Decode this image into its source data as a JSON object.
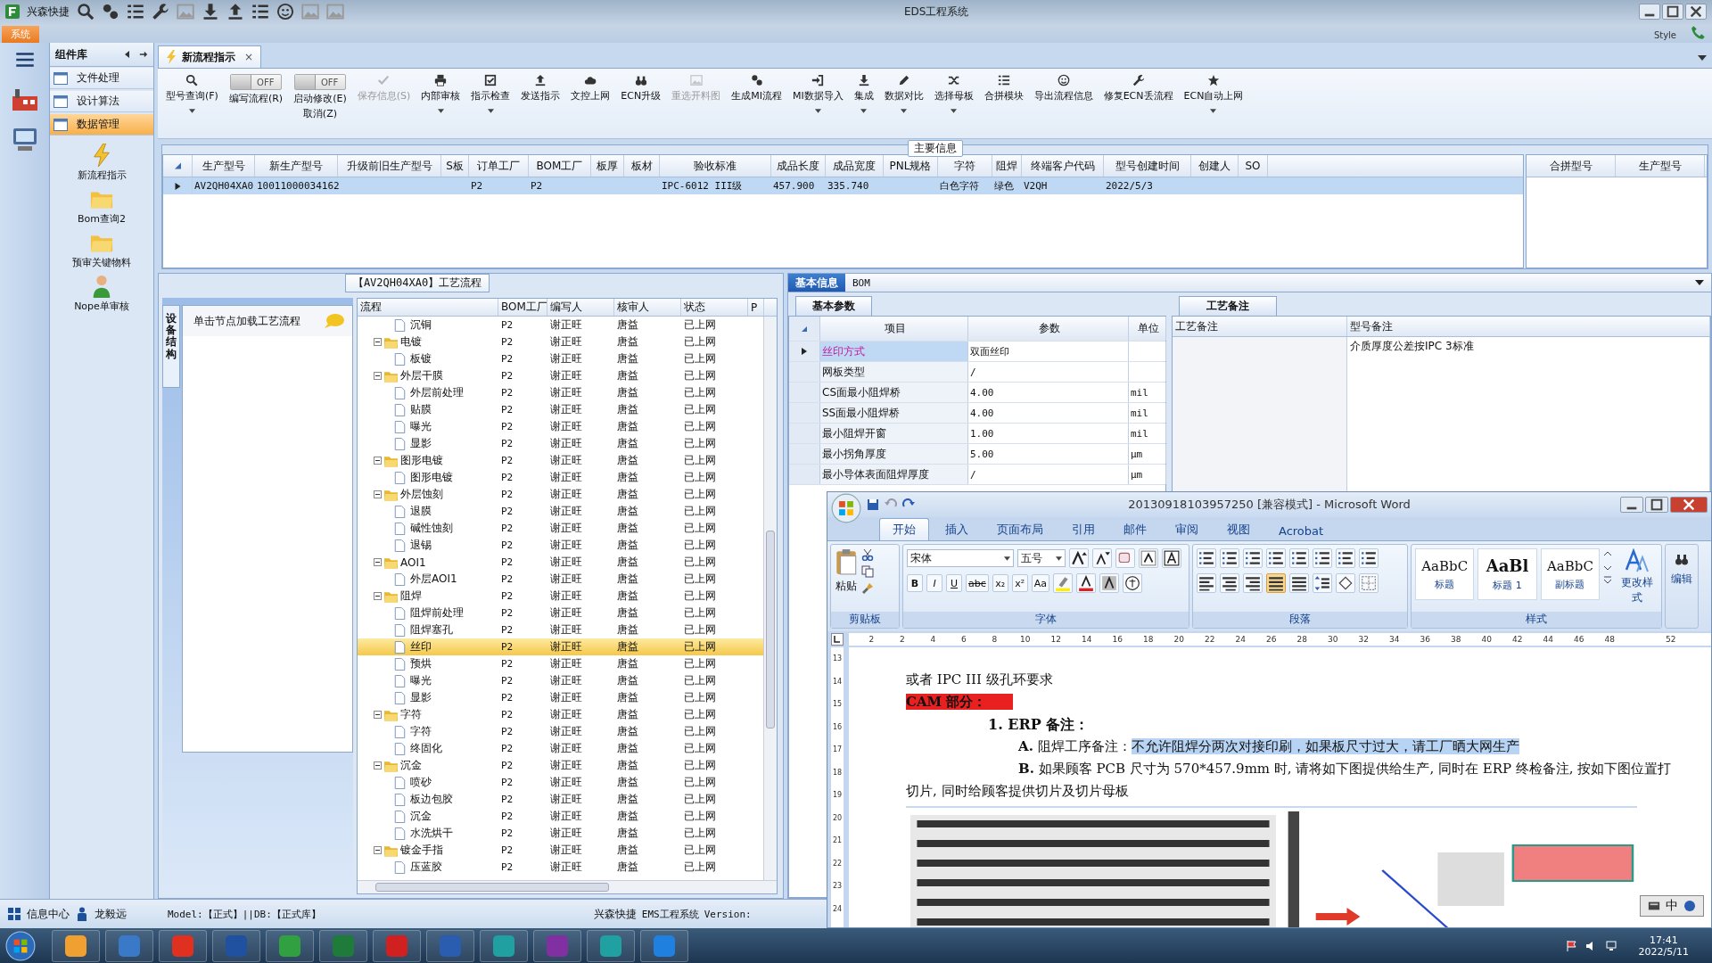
{
  "titlebar": {
    "app_name": "兴森快捷",
    "title": "EDS工程系统",
    "menu_tab": "系统",
    "style_label": "Style"
  },
  "sidebar": {
    "title": "组件库",
    "items": [
      {
        "label": "文件处理",
        "selected": false
      },
      {
        "label": "设计算法",
        "selected": false
      },
      {
        "label": "数据管理",
        "selected": true
      }
    ],
    "tools": [
      {
        "label": "新流程指示"
      },
      {
        "label": "Bom查询2"
      },
      {
        "label": "预审关键物料"
      },
      {
        "label": "Nope单审核"
      }
    ]
  },
  "doc_tab": {
    "label": "新流程指示",
    "close": "×"
  },
  "toolbar": [
    {
      "kind": "button",
      "label": "型号查询(F)",
      "dropdown": true,
      "disabled": false
    },
    {
      "kind": "toggle",
      "label": "编写流程(R)",
      "toggle_text": "OFF",
      "on": false
    },
    {
      "kind": "toggle",
      "label": "启动修改(E)",
      "sublabel": "取消(Z)",
      "toggle_text": "OFF",
      "on": false
    },
    {
      "kind": "button",
      "label": "保存信息(S)",
      "dropdown": false,
      "disabled": true
    },
    {
      "kind": "button",
      "label": "内部审核",
      "dropdown": true,
      "disabled": false
    },
    {
      "kind": "button",
      "label": "指示检查",
      "dropdown": true,
      "disabled": false
    },
    {
      "kind": "button",
      "label": "发送指示",
      "dropdown": false,
      "disabled": false
    },
    {
      "kind": "button",
      "label": "文控上网",
      "dropdown": false,
      "disabled": false
    },
    {
      "kind": "button",
      "label": "ECN升级",
      "dropdown": false,
      "disabled": false
    },
    {
      "kind": "button",
      "label": "重选开料图",
      "dropdown": false,
      "disabled": true
    },
    {
      "kind": "button",
      "label": "生成MI流程",
      "dropdown": false,
      "disabled": false
    },
    {
      "kind": "button",
      "label": "MI数据导入",
      "dropdown": true,
      "disabled": false
    },
    {
      "kind": "button",
      "label": "集成",
      "dropdown": true,
      "disabled": false
    },
    {
      "kind": "button",
      "label": "数据对比",
      "dropdown": true,
      "disabled": false
    },
    {
      "kind": "button",
      "label": "选择母板",
      "dropdown": true,
      "disabled": false
    },
    {
      "kind": "button",
      "label": "合拼模块",
      "dropdown": false,
      "disabled": false
    },
    {
      "kind": "button",
      "label": "导出流程信息",
      "dropdown": false,
      "disabled": false
    },
    {
      "kind": "button",
      "label": "修复ECN丢流程",
      "dropdown": false,
      "disabled": false
    },
    {
      "kind": "button",
      "label": "ECN自动上网",
      "dropdown": true,
      "disabled": false
    }
  ],
  "main_info": {
    "title": "主要信息",
    "columns": [
      "生产型号",
      "新生产型号",
      "升级前旧生产型号",
      "S板",
      "订单工厂",
      "BOM工厂",
      "板厚",
      "板材",
      "验收标准",
      "成品长度",
      "成品宽度",
      "PNL规格",
      "字符",
      "阻焊",
      "终端客户代码",
      "型号创建时间",
      "创建人",
      "SO"
    ],
    "rows": [
      {
        "selected": true,
        "cells": [
          "AV2QH04XA0",
          "10011000034162",
          null,
          null,
          "P2",
          "P2",
          null,
          null,
          "IPC-6012 III级",
          "457.900",
          "335.740",
          null,
          "白色字符",
          "绿色",
          "V2QH",
          "2022/5/3",
          null,
          null
        ]
      }
    ],
    "side_columns": [
      "合拼型号",
      "生产型号"
    ]
  },
  "flow": {
    "title": "【AV2QH04XA0】工艺流程",
    "side_tab": "设备结构",
    "hint": "单击节点加载工艺流程",
    "columns": [
      "流程",
      "BOM工厂",
      "编写人",
      "核审人",
      "状态",
      "P"
    ],
    "rows": [
      {
        "label": "沉铜",
        "bom": "P2",
        "writer": "谢正旺",
        "reviewer": "唐益",
        "status": "已上网",
        "selected": false
      },
      {
        "label": "电镀",
        "bom": "P2",
        "writer": "谢正旺",
        "reviewer": "唐益",
        "status": "已上网",
        "selected": false,
        "expanded": true,
        "children": [
          {
            "label": "板镀",
            "bom": "P2",
            "writer": "谢正旺",
            "reviewer": "唐益",
            "status": "已上网",
            "selected": false
          }
        ]
      },
      {
        "label": "外层干膜",
        "bom": "P2",
        "writer": "谢正旺",
        "reviewer": "唐益",
        "status": "已上网",
        "selected": false,
        "expanded": true,
        "children": [
          {
            "label": "外层前处理",
            "bom": "P2",
            "writer": "谢正旺",
            "reviewer": "唐益",
            "status": "已上网",
            "selected": false
          },
          {
            "label": "贴膜",
            "bom": "P2",
            "writer": "谢正旺",
            "reviewer": "唐益",
            "status": "已上网",
            "selected": false
          },
          {
            "label": "曝光",
            "bom": "P2",
            "writer": "谢正旺",
            "reviewer": "唐益",
            "status": "已上网",
            "selected": false
          },
          {
            "label": "显影",
            "bom": "P2",
            "writer": "谢正旺",
            "reviewer": "唐益",
            "status": "已上网",
            "selected": false
          }
        ]
      },
      {
        "label": "图形电镀",
        "bom": "P2",
        "writer": "谢正旺",
        "reviewer": "唐益",
        "status": "已上网",
        "selected": false,
        "expanded": true,
        "children": [
          {
            "label": "图形电镀",
            "bom": "P2",
            "writer": "谢正旺",
            "reviewer": "唐益",
            "status": "已上网",
            "selected": false
          }
        ]
      },
      {
        "label": "外层蚀刻",
        "bom": "P2",
        "writer": "谢正旺",
        "reviewer": "唐益",
        "status": "已上网",
        "selected": false,
        "expanded": true,
        "children": [
          {
            "label": "退膜",
            "bom": "P2",
            "writer": "谢正旺",
            "reviewer": "唐益",
            "status": "已上网",
            "selected": false
          },
          {
            "label": "碱性蚀刻",
            "bom": "P2",
            "writer": "谢正旺",
            "reviewer": "唐益",
            "status": "已上网",
            "selected": false
          },
          {
            "label": "退锡",
            "bom": "P2",
            "writer": "谢正旺",
            "reviewer": "唐益",
            "status": "已上网",
            "selected": false
          }
        ]
      },
      {
        "label": "AOI1",
        "bom": "P2",
        "writer": "谢正旺",
        "reviewer": "唐益",
        "status": "已上网",
        "selected": false,
        "expanded": true,
        "children": [
          {
            "label": "外层AOI1",
            "bom": "P2",
            "writer": "谢正旺",
            "reviewer": "唐益",
            "status": "已上网",
            "selected": false
          }
        ]
      },
      {
        "label": "阻焊",
        "bom": "P2",
        "writer": "谢正旺",
        "reviewer": "唐益",
        "status": "已上网",
        "selected": false,
        "expanded": true,
        "children": [
          {
            "label": "阻焊前处理",
            "bom": "P2",
            "writer": "谢正旺",
            "reviewer": "唐益",
            "status": "已上网",
            "selected": false
          },
          {
            "label": "阻焊塞孔",
            "bom": "P2",
            "writer": "谢正旺",
            "reviewer": "唐益",
            "status": "已上网",
            "selected": false
          },
          {
            "label": "丝印",
            "bom": "P2",
            "writer": "谢正旺",
            "reviewer": "唐益",
            "status": "已上网",
            "selected": true
          },
          {
            "label": "预烘",
            "bom": "P2",
            "writer": "谢正旺",
            "reviewer": "唐益",
            "status": "已上网",
            "selected": false
          },
          {
            "label": "曝光",
            "bom": "P2",
            "writer": "谢正旺",
            "reviewer": "唐益",
            "status": "已上网",
            "selected": false
          },
          {
            "label": "显影",
            "bom": "P2",
            "writer": "谢正旺",
            "reviewer": "唐益",
            "status": "已上网",
            "selected": false
          }
        ]
      },
      {
        "label": "字符",
        "bom": "P2",
        "writer": "谢正旺",
        "reviewer": "唐益",
        "status": "已上网",
        "selected": false,
        "expanded": true,
        "children": [
          {
            "label": "字符",
            "bom": "P2",
            "writer": "谢正旺",
            "reviewer": "唐益",
            "status": "已上网",
            "selected": false
          },
          {
            "label": "终固化",
            "bom": "P2",
            "writer": "谢正旺",
            "reviewer": "唐益",
            "status": "已上网",
            "selected": false
          }
        ]
      },
      {
        "label": "沉金",
        "bom": "P2",
        "writer": "谢正旺",
        "reviewer": "唐益",
        "status": "已上网",
        "selected": false,
        "expanded": true,
        "children": [
          {
            "label": "喷砂",
            "bom": "P2",
            "writer": "谢正旺",
            "reviewer": "唐益",
            "status": "已上网",
            "selected": false
          },
          {
            "label": "板边包胶",
            "bom": "P2",
            "writer": "谢正旺",
            "reviewer": "唐益",
            "status": "已上网",
            "selected": false
          },
          {
            "label": "沉金",
            "bom": "P2",
            "writer": "谢正旺",
            "reviewer": "唐益",
            "status": "已上网",
            "selected": false
          },
          {
            "label": "水洗烘干",
            "bom": "P2",
            "writer": "谢正旺",
            "reviewer": "唐益",
            "status": "已上网",
            "selected": false
          }
        ]
      },
      {
        "label": "镀金手指",
        "bom": "P2",
        "writer": "谢正旺",
        "reviewer": "唐益",
        "status": "已上网",
        "selected": false,
        "expanded": true,
        "children": [
          {
            "label": "压蓝胶",
            "bom": "P2",
            "writer": "谢正旺",
            "reviewer": "唐益",
            "status": "已上网",
            "selected": false
          }
        ]
      }
    ]
  },
  "details": {
    "tabs": [
      {
        "label": "基本信息",
        "selected": true
      },
      {
        "label": "BOM",
        "selected": false
      }
    ],
    "params": {
      "tab": "基本参数",
      "columns": [
        "项目",
        "参数",
        "单位"
      ],
      "rows": [
        {
          "item": "丝印方式",
          "value": "双面丝印",
          "selected": true
        },
        {
          "item": "网板类型",
          "value": "/",
          "selected": false
        },
        {
          "item": "CS面最小阻焊桥",
          "value": "4.00",
          "unit": "mil",
          "selected": false
        },
        {
          "item": "SS面最小阻焊桥",
          "value": "4.00",
          "unit": "mil",
          "selected": false
        },
        {
          "item": "最小阻焊开窗",
          "value": "1.00",
          "unit": "mil",
          "selected": false
        },
        {
          "item": "最小拐角厚度",
          "value": "5.00",
          "unit": "μm",
          "selected": false
        },
        {
          "item": "最小导体表面阻焊厚度",
          "value": "/",
          "unit": "μm",
          "selected": false
        }
      ]
    },
    "notes": {
      "tab": "工艺备注",
      "columns": [
        "工艺备注",
        "型号备注"
      ],
      "model_note": "介质厚度公差按IPC 3标准"
    }
  },
  "status_bar": {
    "info_center": "信息中心",
    "user": "龙毅远",
    "model": "Model:【正式】||DB:【正式库】",
    "app": "兴森快捷",
    "system": "EMS工程系统",
    "version": "Version:"
  },
  "taskbar": {
    "time": "17:41",
    "date": "2022/5/11"
  },
  "word": {
    "title": "20130918103957250 [兼容模式] - Microsoft Word",
    "tabs": [
      {
        "label": "开始",
        "selected": true
      },
      {
        "label": "插入",
        "selected": false
      },
      {
        "label": "页面布局",
        "selected": false
      },
      {
        "label": "引用",
        "selected": false
      },
      {
        "label": "邮件",
        "selected": false
      },
      {
        "label": "审阅",
        "selected": false
      },
      {
        "label": "视图",
        "selected": false
      },
      {
        "label": "Acrobat",
        "selected": false
      }
    ],
    "clipboard": {
      "paste": "粘贴",
      "group": "剪贴板"
    },
    "font": {
      "name": "宋体",
      "size": "五号",
      "group": "字体",
      "buttons": [
        "B",
        "I",
        "U",
        "abc",
        "x₂",
        "x²",
        "Aa"
      ]
    },
    "paragraph": {
      "group": "段落"
    },
    "styles": {
      "group": "样式",
      "items": [
        {
          "sample": "AaBbC",
          "label": "标题"
        },
        {
          "sample": "AaBl",
          "label": "标题 1"
        },
        {
          "sample": "AaBbC",
          "label": "副标题"
        }
      ],
      "change": "更改样式"
    },
    "editing": "编辑",
    "ruler": [
      "2",
      "2",
      "4",
      "6",
      "8",
      "10",
      "12",
      "14",
      "16",
      "18",
      "20",
      "22",
      "24",
      "26",
      "28",
      "30",
      "32",
      "34",
      "36",
      "38",
      "40",
      "42",
      "44",
      "46",
      "48",
      "52"
    ],
    "vruler": [
      "13",
      "14",
      "15",
      "16",
      "17",
      "18",
      "19",
      "20",
      "21",
      "22",
      "23",
      "24"
    ],
    "paragraphs": [
      {
        "kind": "plain",
        "text": "或者 IPC III 级孔环要求"
      },
      {
        "kind": "banner",
        "text": "CAM 部分："
      },
      {
        "kind": "heading",
        "text": "1. ERP 备注："
      },
      {
        "kind": "item",
        "label": "A.",
        "text": "阻焊工序备注：",
        "highlight": "不允许阻焊分两次对接印刷，如果板尺寸过大，请工厂晒大网生产"
      },
      {
        "kind": "item",
        "label": "B.",
        "text": "如果顾客 PCB 尺寸为 570*457.9mm 时, 请将如下图提供给生产, 同时在 ERP 终检备注, 按如下图位置打切片, 同时给顾客提供切片及切片母板"
      }
    ],
    "ime": "中"
  }
}
